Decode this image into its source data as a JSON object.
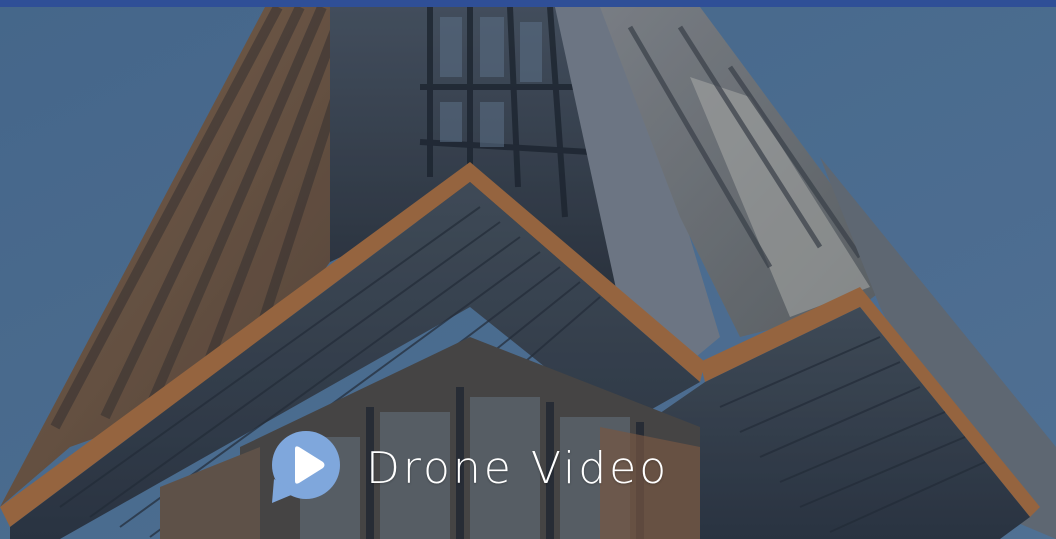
{
  "hero": {
    "image": "building-exterior-photo",
    "cta": {
      "label": "Drone Video",
      "icon": "play-chat-bubble-icon"
    }
  },
  "colors": {
    "top_bar": "#2f4f97",
    "sky": "#4d7399",
    "icon_fill": "#7fa7dc",
    "label": "#ffffff"
  }
}
